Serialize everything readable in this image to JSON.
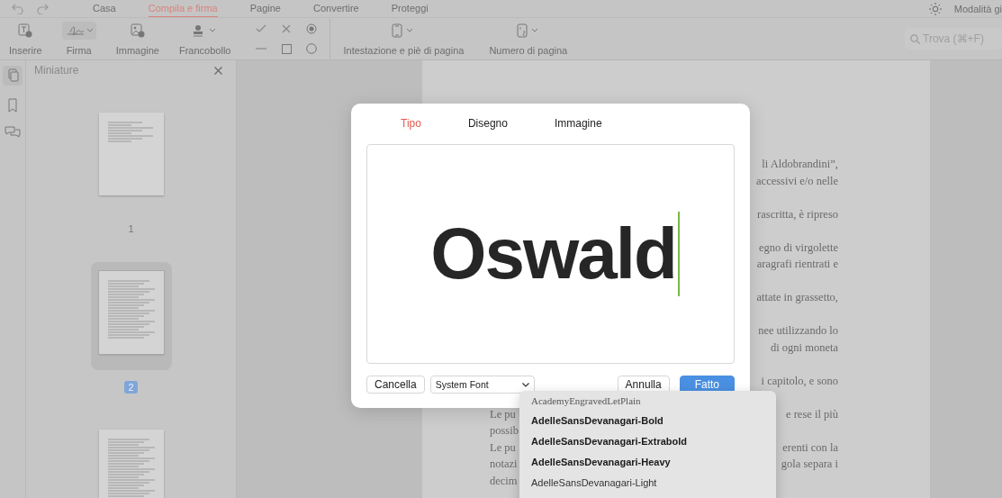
{
  "tabs": [
    {
      "label": "Casa",
      "selected": false
    },
    {
      "label": "Compila e firma",
      "selected": true
    },
    {
      "label": "Pagine",
      "selected": false
    },
    {
      "label": "Convertire",
      "selected": false
    },
    {
      "label": "Proteggi",
      "selected": false
    }
  ],
  "mode_label": "Modalità gi",
  "tools": [
    {
      "label": "Inserire",
      "kind": "insert"
    },
    {
      "label": "Firma",
      "kind": "signature"
    },
    {
      "label": "Immagine",
      "kind": "image"
    },
    {
      "label": "Francobollo",
      "kind": "stamp"
    }
  ],
  "tools_after": [
    {
      "label": "Intestazione e piè di pagina",
      "kind": "header"
    },
    {
      "label": "Numero di pagina",
      "kind": "page-number"
    }
  ],
  "search": {
    "placeholder": "Trova (⌘+F)"
  },
  "sidebar": {
    "title": "Miniature",
    "thumbnails": [
      {
        "label": "1",
        "selected": false
      },
      {
        "label": "2",
        "selected": true
      },
      {
        "selected": false
      }
    ]
  },
  "document": {
    "paragraphs": [
      [
        {
          "right": "li Aldobrandini”,"
        },
        {
          "right": "accessivi e/o nelle"
        }
      ],
      [
        {
          "right": "rascritta, è ripreso"
        }
      ],
      [
        {
          "right": "egno di virgolette"
        },
        {
          "right": "aragrafi rientrati e"
        }
      ],
      [
        {
          "right": "attate in grassetto,"
        }
      ],
      [
        {
          "right": "nee utilizzando lo"
        },
        {
          "right": "di ogni moneta"
        }
      ],
      [
        {
          "right": "i capitolo, e sono"
        }
      ],
      [
        {
          "left": "Le pu",
          "right": "e rese il più"
        },
        {
          "left": "possib"
        },
        {
          "left": "Le pu",
          "right": "erenti con la"
        },
        {
          "left": "notazi",
          "right": "gola separa i"
        },
        {
          "left": "decim"
        }
      ]
    ]
  },
  "dialog": {
    "tabs": [
      {
        "label": "Tipo",
        "selected": true
      },
      {
        "label": "Disegno",
        "selected": false
      },
      {
        "label": "Immagine",
        "selected": false
      }
    ],
    "signature": "Oswald",
    "clear_button": "Cancella",
    "font": "System Font",
    "cancel_button": "Annulla",
    "done_button": "Fatto"
  },
  "font_menu": [
    {
      "name": "AcademyEngravedLetPlain",
      "kind": "engraved"
    },
    {
      "name": "AdelleSansDevanagari-Bold",
      "kind": "bold"
    },
    {
      "name": "AdelleSansDevanagari-Extrabold",
      "kind": "extrabold"
    },
    {
      "name": "AdelleSansDevanagari-Heavy",
      "kind": "heavy"
    },
    {
      "name": "AdelleSansDevanagari-Light",
      "kind": "light"
    }
  ]
}
